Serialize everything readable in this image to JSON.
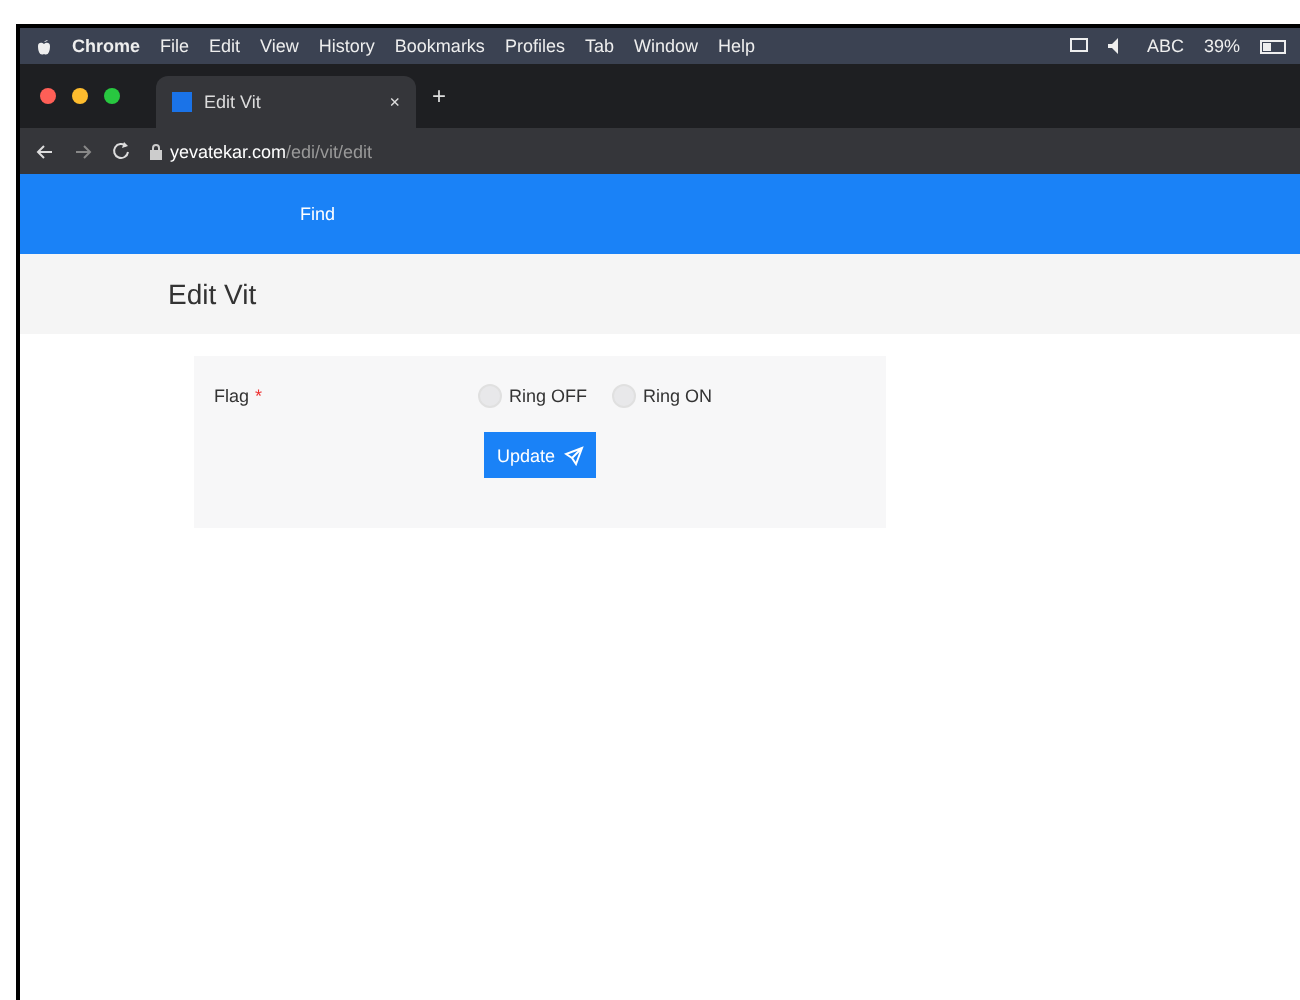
{
  "menu_bar": {
    "app": "Chrome",
    "items": [
      "File",
      "Edit",
      "View",
      "History",
      "Bookmarks",
      "Profiles",
      "Tab",
      "Window",
      "Help"
    ],
    "input_source": "ABC",
    "battery": "39%"
  },
  "tab": {
    "title": "Edit Vit",
    "close": "×",
    "new_tab": "+"
  },
  "address": {
    "host": "yevatekar.com",
    "path": "/edi/vit/edit"
  },
  "nav": {
    "items": [
      {
        "label": "Find",
        "selected": false
      }
    ]
  },
  "page_title": "Edit Vit",
  "form": {
    "label": "Flag",
    "required_mark": "*",
    "options": [
      {
        "label": "Ring OFF",
        "selected": false
      },
      {
        "label": "Ring ON",
        "selected": false
      }
    ],
    "submit": "Update"
  }
}
